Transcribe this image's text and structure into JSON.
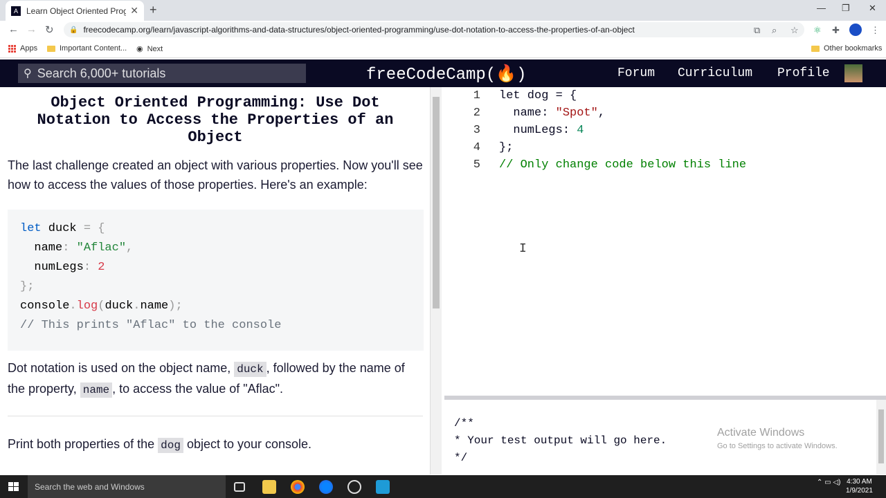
{
  "browser": {
    "tab_title": "Learn Object Oriented Programm",
    "tab_favicon": "A",
    "new_tab": "+",
    "url": "freecodecamp.org/learn/javascript-algorithms-and-data-structures/object-oriented-programming/use-dot-notation-to-access-the-properties-of-an-object",
    "bookmarks": [
      "Apps",
      "Important Content...",
      "Next"
    ],
    "other_bookmarks": "Other bookmarks"
  },
  "fcc": {
    "search_placeholder": "Search 6,000+ tutorials",
    "logo": "freeCodeCamp(🔥)",
    "nav": [
      "Forum",
      "Curriculum",
      "Profile"
    ]
  },
  "lesson": {
    "title": "Object Oriented Programming: Use Dot Notation to Access the Properties of an Object",
    "intro": "The last challenge created an object with various properties. Now you'll see how to access the values of those properties. Here's an example:",
    "example_code": [
      "let duck = {",
      "  name: \"Aflac\",",
      "  numLegs: 2",
      "};",
      "console.log(duck.name);",
      "// This prints \"Aflac\" to the console"
    ],
    "dot_text_1": "Dot notation is used on the object name, ",
    "dot_code_1": "duck",
    "dot_text_2": ", followed by the name of the property, ",
    "dot_code_2": "name",
    "dot_text_3": ", to access the value of \"Aflac\".",
    "task_text_1": "Print both properties of the ",
    "task_code": "dog",
    "task_text_2": " object to your console."
  },
  "editor": {
    "lines": [
      {
        "n": "1",
        "code": "let dog = {"
      },
      {
        "n": "2",
        "code": "  name: \"Spot\","
      },
      {
        "n": "3",
        "code": "  numLegs: 4"
      },
      {
        "n": "4",
        "code": "};"
      },
      {
        "n": "5",
        "code": "// Only change code below this line"
      }
    ]
  },
  "console": {
    "lines": [
      "/**",
      "* Your test output will go here.",
      "*/"
    ]
  },
  "watermark": {
    "line1": "Activate Windows",
    "line2": "Go to Settings to activate Windows."
  },
  "taskbar": {
    "search_placeholder": "Search the web and Windows",
    "time": "4:30 AM",
    "date": "1/9/2021"
  }
}
